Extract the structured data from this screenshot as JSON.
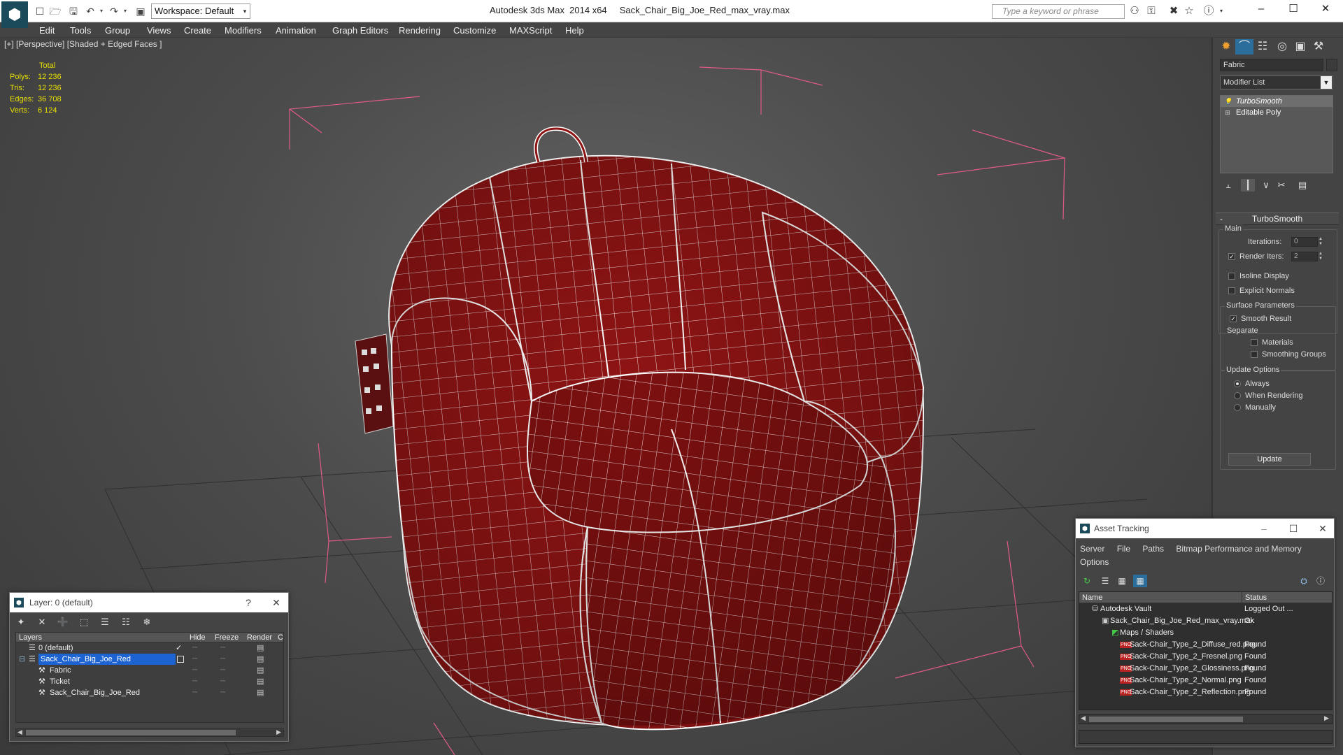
{
  "app": {
    "title": "Autodesk 3ds Max  2014 x64     Sack_Chair_Big_Joe_Red_max_vray.max",
    "workspace": "Workspace: Default",
    "search_placeholder": "Type a keyword or phrase"
  },
  "menu": [
    "Edit",
    "Tools",
    "Group",
    "Views",
    "Create",
    "Modifiers",
    "Animation",
    "Graph Editors",
    "Rendering",
    "Customize",
    "MAXScript",
    "Help"
  ],
  "viewport": {
    "label": "[+] [Perspective] [Shaded + Edged Faces ]",
    "stats": {
      "header": "Total",
      "rows": [
        {
          "label": "Polys:",
          "value": "12 236"
        },
        {
          "label": "Tris:",
          "value": "12 236"
        },
        {
          "label": "Edges:",
          "value": "36 708"
        },
        {
          "label": "Verts:",
          "value": "6 124"
        }
      ]
    },
    "model_color": "#8f1414",
    "wire_color": "#ffffff",
    "bbox_color": "#e05a8a"
  },
  "command_panel": {
    "object_name": "Fabric",
    "modifier_list": "Modifier List",
    "stack": [
      "TurboSmooth",
      "Editable Poly"
    ],
    "rollout": "TurboSmooth",
    "main": {
      "title": "Main",
      "iterations_label": "Iterations:",
      "iterations": "0",
      "render_iters_label": "Render Iters:",
      "render_iters": "2",
      "isoline": "Isoline Display",
      "explicit": "Explicit Normals"
    },
    "surface": {
      "title": "Surface Parameters",
      "smooth": "Smooth Result",
      "separate": "Separate",
      "materials": "Materials",
      "smoothing_groups": "Smoothing Groups"
    },
    "update": {
      "title": "Update Options",
      "always": "Always",
      "when_rendering": "When Rendering",
      "manually": "Manually",
      "button": "Update"
    }
  },
  "layer_dialog": {
    "title": "Layer: 0 (default)",
    "help": "?",
    "columns": [
      "Layers",
      "Hide",
      "Freeze",
      "Render",
      "C"
    ],
    "rows": [
      {
        "name": "0 (default)",
        "indent": 1,
        "current": true
      },
      {
        "name": "Sack_Chair_Big_Joe_Red",
        "indent": 1,
        "selected": true
      },
      {
        "name": "Fabric",
        "indent": 2
      },
      {
        "name": "Ticket",
        "indent": 2
      },
      {
        "name": "Sack_Chair_Big_Joe_Red",
        "indent": 2
      }
    ]
  },
  "asset_dialog": {
    "title": "Asset Tracking",
    "menu": [
      "Server",
      "File",
      "Paths",
      "Bitmap Performance and Memory",
      "Options"
    ],
    "columns": [
      "Name",
      "Status"
    ],
    "rows": [
      {
        "name": "Autodesk Vault",
        "status": "Logged Out ...",
        "indent": 0
      },
      {
        "name": "Sack_Chair_Big_Joe_Red_max_vray.max",
        "status": "Ok",
        "indent": 1
      },
      {
        "name": "Maps / Shaders",
        "status": "",
        "indent": 2
      },
      {
        "name": "Sack-Chair_Type_2_Diffuse_red.png",
        "status": "Found",
        "indent": 3
      },
      {
        "name": "Sack-Chair_Type_2_Fresnel.png",
        "status": "Found",
        "indent": 3
      },
      {
        "name": "Sack-Chair_Type_2_Glossiness.png",
        "status": "Found",
        "indent": 3
      },
      {
        "name": "Sack-Chair_Type_2_Normal.png",
        "status": "Found",
        "indent": 3
      },
      {
        "name": "Sack-Chair_Type_2_Reflection.png",
        "status": "Found",
        "indent": 3
      }
    ]
  }
}
